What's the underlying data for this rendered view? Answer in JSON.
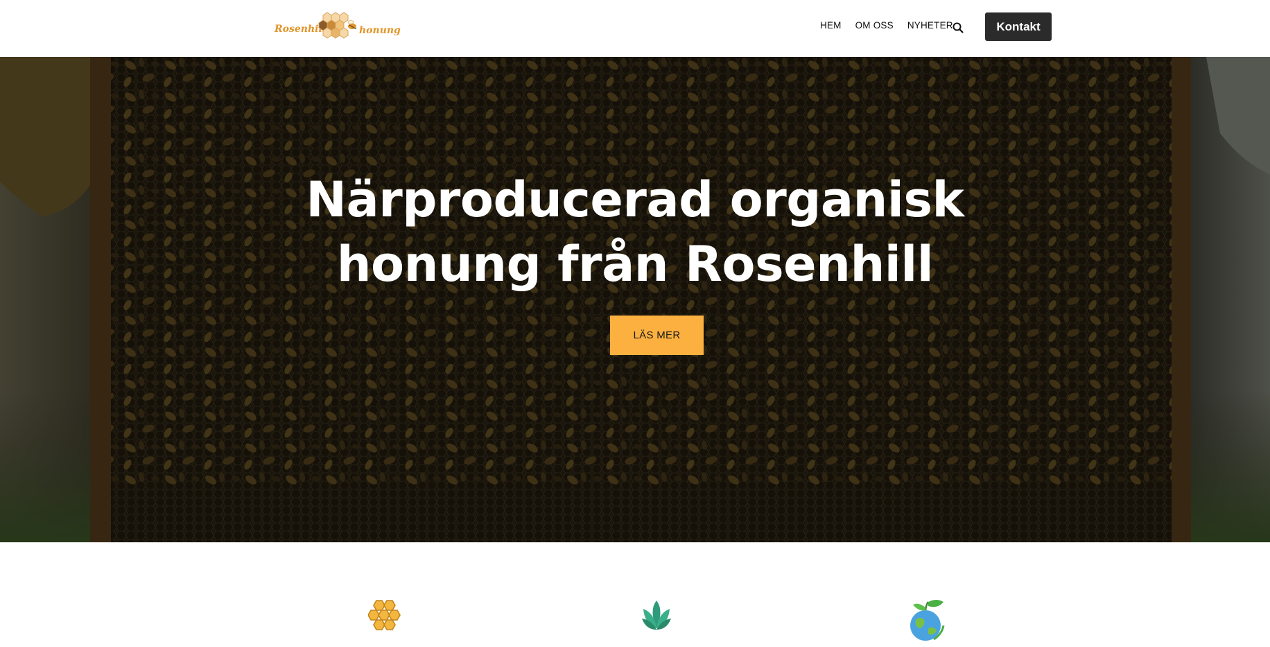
{
  "header": {
    "logo": {
      "left_text": "Rosenhill",
      "right_text": "honung"
    },
    "nav": [
      {
        "label": "HEM"
      },
      {
        "label": "OM OSS"
      },
      {
        "label": "NYHETER"
      }
    ],
    "search_icon": "search-icon",
    "contact_label": "Kontakt"
  },
  "hero": {
    "title_line1": "Närproducerad organisk",
    "title_line2": "honung från Rosenhill",
    "cta_label": "LÄS MER"
  },
  "features": {
    "icons": [
      "honeycomb-icon",
      "lotus-leaf-icon",
      "earth-plant-icon"
    ]
  },
  "colors": {
    "accent": "#fcb040",
    "dark_button": "#2b2b2b",
    "logo_orange": "#e2952a",
    "leaf_green": "#2f9b7a"
  }
}
